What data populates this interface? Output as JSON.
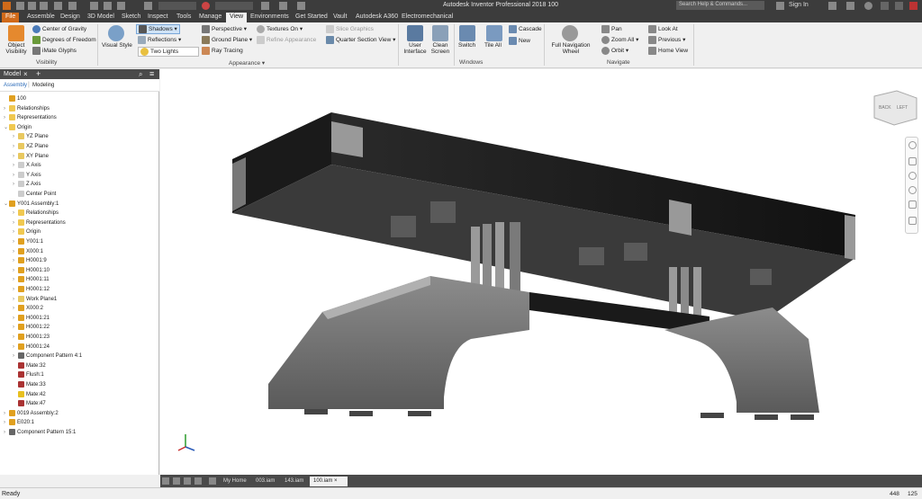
{
  "app": {
    "title": "Autodesk Inventor Professional 2018   100",
    "search_placeholder": "Search Help & Commands...",
    "sign_in": "Sign In"
  },
  "tabs": [
    "File",
    "Assemble",
    "Design",
    "3D Model",
    "Sketch",
    "Inspect",
    "Tools",
    "Manage",
    "View",
    "Environments",
    "Get Started",
    "Vault",
    "Autodesk A360",
    "Electromechanical"
  ],
  "ribbon": {
    "visibility": {
      "object_visibility": "Object Visibility",
      "center_of_gravity": "Center of Gravity",
      "degrees_of_freedom": "Degrees of Freedom",
      "imate_glyphs": "iMate Glyphs",
      "label": "Visibility"
    },
    "appearance": {
      "visual_style": "Visual Style",
      "shadows": "Shadows",
      "reflections": "Reflections",
      "two_lights": "Two Lights",
      "perspective": "Perspective",
      "ground_plane": "Ground Plane",
      "ray_tracing": "Ray Tracing",
      "textures_on": "Textures On",
      "refine_appearance": "Refine Appearance",
      "slice_graphics": "Slice Graphics",
      "quarter_section_view": "Quarter Section View",
      "label": "Appearance"
    },
    "windows": {
      "user_interface": "User Interface",
      "clean_screen": "Clean Screen",
      "switch": "Switch",
      "tile_all": "Tile All",
      "cascade": "Cascade",
      "new": "New",
      "label": "Windows"
    },
    "navigate": {
      "full_navigation_wheel": "Full Navigation Wheel",
      "pan": "Pan",
      "zoom_all": "Zoom All",
      "orbit": "Orbit",
      "look_at": "Look At",
      "previous": "Previous",
      "home_view": "Home View",
      "label": "Navigate"
    }
  },
  "browser": {
    "header": "Model",
    "tab_assembly": "Assembly",
    "tab_modeling": "Modeling",
    "nodes": [
      {
        "label": "100",
        "level": 0,
        "exp": "",
        "icon": "assembly-icon"
      },
      {
        "label": "Relationships",
        "level": 0,
        "exp": "›",
        "icon": "folder-icon"
      },
      {
        "label": "Representations",
        "level": 0,
        "exp": "›",
        "icon": "folder-icon"
      },
      {
        "label": "Origin",
        "level": 0,
        "exp": "⌄",
        "icon": "folder-icon"
      },
      {
        "label": "YZ Plane",
        "level": 1,
        "exp": "›",
        "icon": "plane-icon"
      },
      {
        "label": "XZ Plane",
        "level": 1,
        "exp": "›",
        "icon": "plane-icon"
      },
      {
        "label": "XY Plane",
        "level": 1,
        "exp": "›",
        "icon": "plane-icon"
      },
      {
        "label": "X Axis",
        "level": 1,
        "exp": "›",
        "icon": "axis-icon"
      },
      {
        "label": "Y Axis",
        "level": 1,
        "exp": "›",
        "icon": "axis-icon"
      },
      {
        "label": "Z Axis",
        "level": 1,
        "exp": "›",
        "icon": "axis-icon"
      },
      {
        "label": "Center Point",
        "level": 1,
        "exp": "",
        "icon": "point-icon"
      },
      {
        "label": "Y001 Assembly:1",
        "level": 0,
        "exp": "⌄",
        "icon": "assembly-icon"
      },
      {
        "label": "Relationships",
        "level": 1,
        "exp": "›",
        "icon": "folder-icon"
      },
      {
        "label": "Representations",
        "level": 1,
        "exp": "›",
        "icon": "folder-icon"
      },
      {
        "label": "Origin",
        "level": 1,
        "exp": "›",
        "icon": "folder-icon"
      },
      {
        "label": "Y001:1",
        "level": 1,
        "exp": "›",
        "icon": "part-icon"
      },
      {
        "label": "X000:1",
        "level": 1,
        "exp": "›",
        "icon": "part-icon"
      },
      {
        "label": "H0001:9",
        "level": 1,
        "exp": "›",
        "icon": "part-icon"
      },
      {
        "label": "H0001:10",
        "level": 1,
        "exp": "›",
        "icon": "part-icon"
      },
      {
        "label": "H0001:11",
        "level": 1,
        "exp": "›",
        "icon": "part-icon"
      },
      {
        "label": "H0001:12",
        "level": 1,
        "exp": "›",
        "icon": "part-icon"
      },
      {
        "label": "Work Plane1",
        "level": 1,
        "exp": "›",
        "icon": "plane-icon"
      },
      {
        "label": "X000:2",
        "level": 1,
        "exp": "›",
        "icon": "part-icon"
      },
      {
        "label": "H0001:21",
        "level": 1,
        "exp": "›",
        "icon": "part-icon"
      },
      {
        "label": "H0001:22",
        "level": 1,
        "exp": "›",
        "icon": "part-icon"
      },
      {
        "label": "H0001:23",
        "level": 1,
        "exp": "›",
        "icon": "part-icon"
      },
      {
        "label": "H0001:24",
        "level": 1,
        "exp": "›",
        "icon": "part-icon"
      },
      {
        "label": "Component Pattern 4:1",
        "level": 1,
        "exp": "›",
        "icon": "pattern-icon"
      },
      {
        "label": "Mate:32",
        "level": 1,
        "exp": "",
        "icon": "mate-icon"
      },
      {
        "label": "Flush:1",
        "level": 1,
        "exp": "",
        "icon": "flush-icon"
      },
      {
        "label": "Mate:33",
        "level": 1,
        "exp": "",
        "icon": "mate-icon"
      },
      {
        "label": "Mate:42",
        "level": 1,
        "exp": "",
        "icon": "warning-icon"
      },
      {
        "label": "Mate:47",
        "level": 1,
        "exp": "",
        "icon": "mate-icon"
      },
      {
        "label": "0019 Assembly:2",
        "level": 0,
        "exp": "›",
        "icon": "assembly-icon"
      },
      {
        "label": "E020:1",
        "level": 0,
        "exp": "›",
        "icon": "part-icon"
      },
      {
        "label": "Component Pattern 15:1",
        "level": 0,
        "exp": "›",
        "icon": "pattern-icon"
      }
    ]
  },
  "doc_tabs": {
    "my_home": "My Home",
    "tab1": "003.iam",
    "tab2": "143.iam",
    "tab3": "100.iam"
  },
  "viewcube": {
    "back": "BACK",
    "left": "LEFT"
  },
  "status": {
    "text": "Ready",
    "num1": "448",
    "num2": "125"
  },
  "colors": {
    "accent_orange": "#d06a1a",
    "dark_chrome": "#3c3c3c",
    "shadow_highlight": "#cfe3f7"
  }
}
